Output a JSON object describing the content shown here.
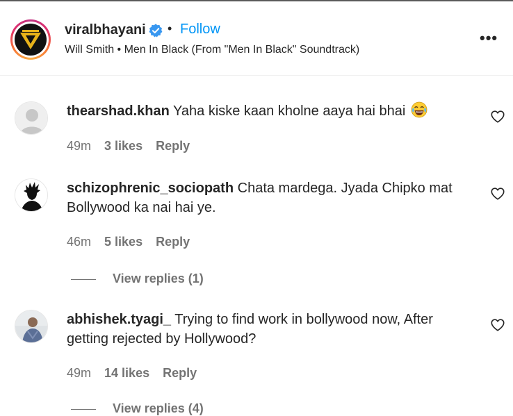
{
  "post": {
    "username": "viralbhayani",
    "follow_label": "Follow",
    "dot": "•",
    "audio_text": "Will Smith • Men In Black (From \"Men In Black\" Soundtrack)",
    "more_label": "•••",
    "verified_icon": "verified-badge-icon",
    "colors": {
      "accent": "#0095f6",
      "verified": "#3897f0",
      "muted": "#737373"
    }
  },
  "comments": [
    {
      "username": "thearshad.khan",
      "text": "Yaha kiske kaan kholne aaya hai bhai",
      "emoji": "face-with-tears-of-joy",
      "time": "49m",
      "likes": "3 likes",
      "reply_label": "Reply"
    },
    {
      "username": "schizophrenic_sociopath",
      "text": "Chata mardega. Jyada Chipko mat Bollywood ka nai hai ye.",
      "time": "46m",
      "likes": "5 likes",
      "reply_label": "Reply",
      "view_replies": "View replies (1)"
    },
    {
      "username": "abhishek.tyagi_",
      "text": "Trying to find work in bollywood now, After getting rejected by Hollywood?",
      "time": "49m",
      "likes": "14 likes",
      "reply_label": "Reply",
      "view_replies": "View replies (4)"
    }
  ]
}
